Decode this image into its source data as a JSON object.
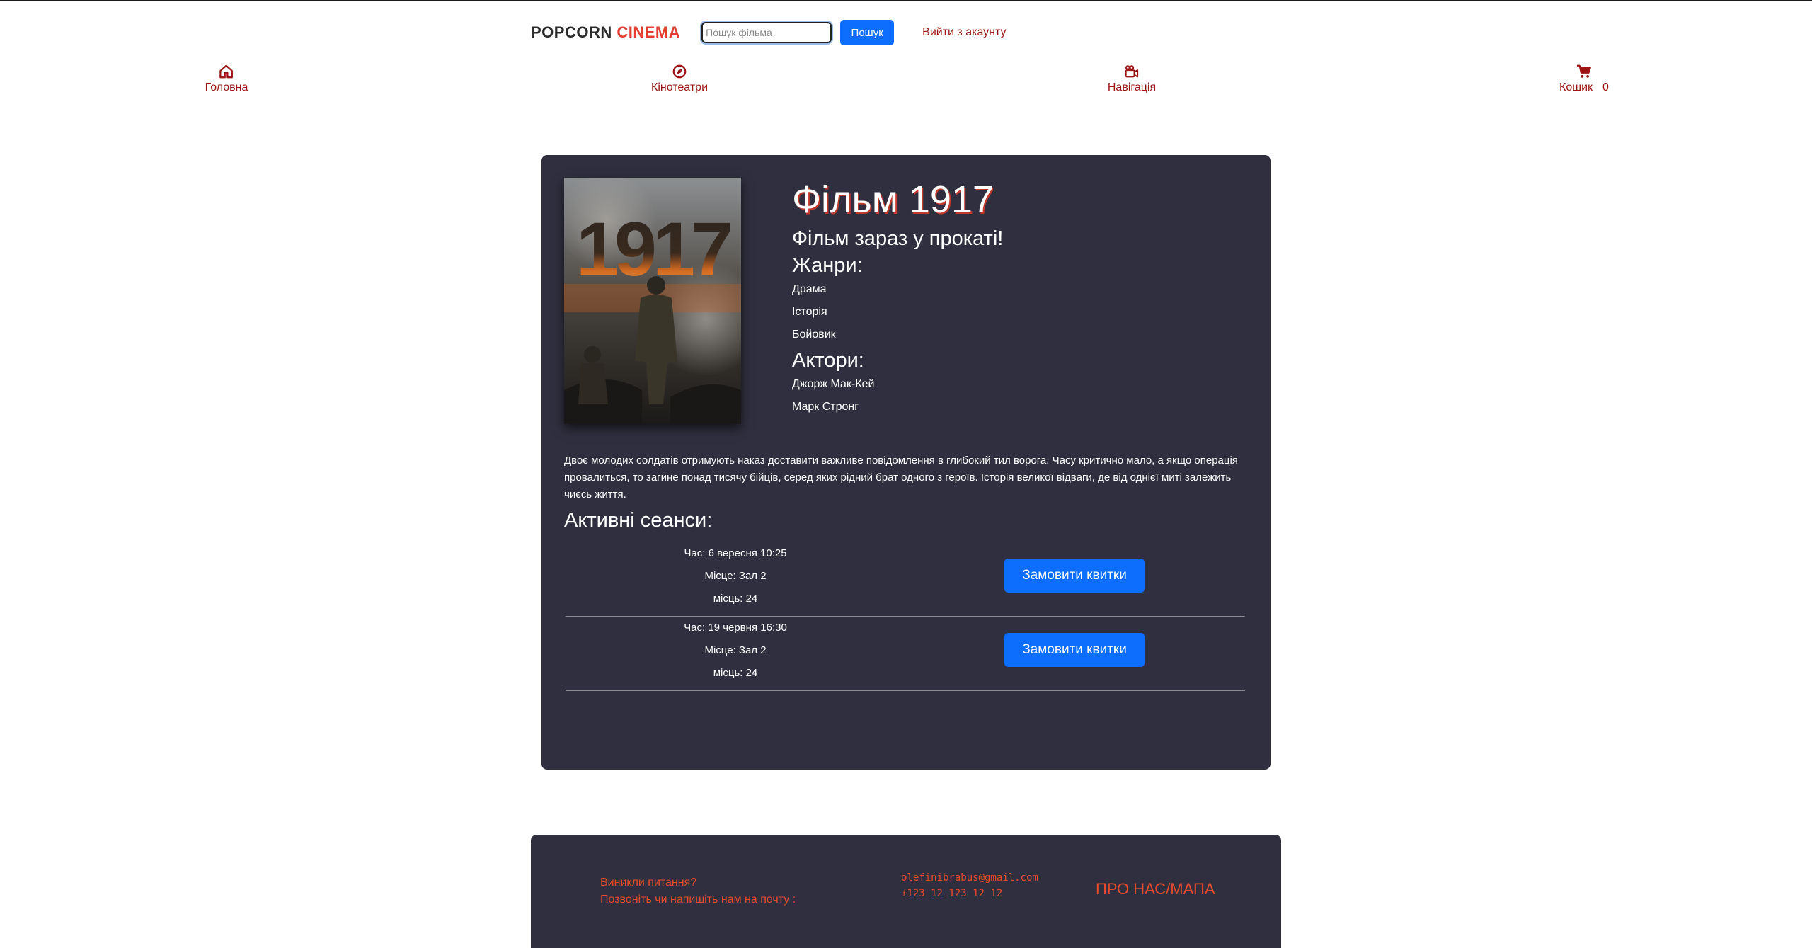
{
  "header": {
    "brand_main": "POPCORN",
    "brand_accent": "CINEMA",
    "search_placeholder": "Пошук фільма",
    "search_button": "Пошук",
    "logout_link": "Вийти з акаунту"
  },
  "nav": {
    "home": {
      "label": "Головна",
      "icon": "home-icon"
    },
    "cinemas": {
      "label": "Кінотеатри",
      "icon": "compass-icon"
    },
    "navigation": {
      "label": "Навігація",
      "icon": "video-camera-icon"
    },
    "cart": {
      "label": "Кошик",
      "count": "0",
      "icon": "cart-icon"
    }
  },
  "movie": {
    "poster_text": "1917",
    "title": "Фільм 1917",
    "status": "Фільм зараз у прокаті!",
    "genres_heading": "Жанри:",
    "genres": [
      "Драма",
      "Історія",
      "Бойовик"
    ],
    "actors_heading": "Актори:",
    "actors": [
      "Джорж Мак-Кей",
      "Марк Стронг"
    ],
    "description": "Двоє молодих солдатів отримують наказ доставити важливе повідомлення в глибокий тил ворога. Часу критично мало, а якщо операція провалиться, то загине понад тисячу бійців, серед яких рідний брат одного з героїв. Історія великої відваги, де від однієї миті залежить чиєсь життя."
  },
  "sessions": {
    "heading": "Активні сеанси:",
    "items": [
      {
        "time": "Час: 6 вересня 10:25",
        "place": "Місце: Зал 2",
        "seats": "місць: 24",
        "button": "Замовити квитки"
      },
      {
        "time": "Час: 19 червня 16:30",
        "place": "Місце: Зал 2",
        "seats": "місць: 24",
        "button": "Замовити квитки"
      }
    ]
  },
  "footer": {
    "question_line1": "Виникли питання?",
    "question_line2": "Позвоніть чи напишіть нам на почту :",
    "email": "olefinibrabus@gmail.com",
    "phone": "+123 12 123 12 12",
    "about": "ПРО НАС/МАПА"
  },
  "colors": {
    "accent_red": "#e43d30",
    "nav_red": "#9c1414",
    "primary_blue": "#0d6efd",
    "card_bg": "#2f2f3f"
  }
}
